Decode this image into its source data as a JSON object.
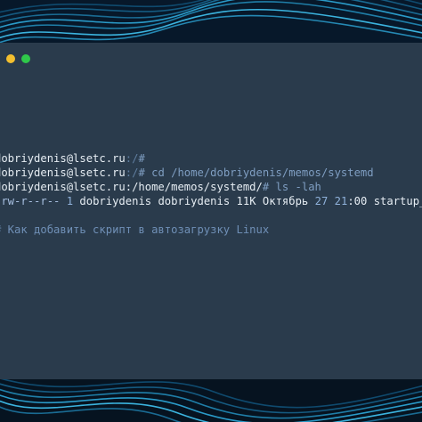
{
  "colors": {
    "terminal_bg": "#2a3b4c",
    "dot_yellow": "#f3bf2f",
    "dot_green": "#2fc84a",
    "text_primary": "#e6edf3",
    "text_accent": "#7f9ec2"
  },
  "window": {
    "controls": [
      "minimize-dot",
      "maximize-dot"
    ]
  },
  "terminal": {
    "line1": {
      "user": "dobriydenis@lsetc.ru",
      "sep": ":/",
      "prompt": "#"
    },
    "line2": {
      "user": "dobriydenis@lsetc.ru",
      "sep": ":/",
      "prompt": "#",
      "command": " cd /home/dobriydenis/memos/systemd"
    },
    "line3": {
      "user": "dobriydenis@lsetc.ru",
      "path": ":/home/memos/systemd/",
      "prompt": "#",
      "command": " ls -lah"
    },
    "line4": {
      "perm": "-rw-r--r--",
      "links": "1",
      "owner": "dobriydenis",
      "group": "dobriydenis",
      "size": "11K",
      "month": "Октябрь",
      "day": "27",
      "time": "21",
      "time_rest": ":00",
      "file": "startup_sh"
    },
    "comment": "# Как добавить скрипт в автозагрузку Linux"
  }
}
